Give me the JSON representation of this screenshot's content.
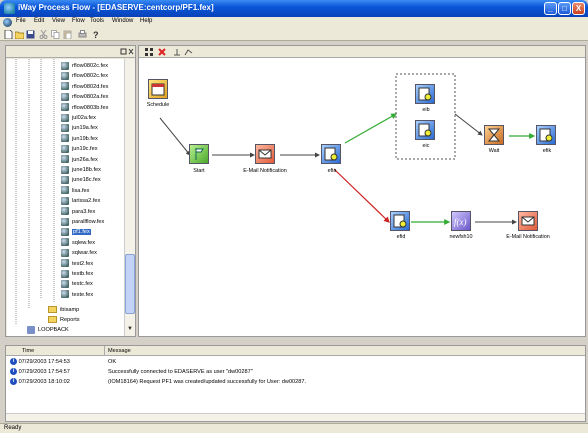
{
  "window": {
    "title": "iWay Process Flow - [EDASERVE:centcorp/PF1.fex]",
    "minimize": "_",
    "maximize": "□",
    "close": "X"
  },
  "menu": [
    "File",
    "Edit",
    "View",
    "Flow",
    "Tools",
    "Window",
    "Help"
  ],
  "toolbar_icons": [
    "new-icon",
    "open-icon",
    "save-icon",
    "cut-icon",
    "copy-icon",
    "paste-icon",
    "print-icon",
    "help-icon"
  ],
  "canvas_toolbar_icons": [
    "grid-icon",
    "delete-icon",
    "align-icon",
    "route-icon"
  ],
  "tree": {
    "items": [
      "rflow0802c.fex",
      "rflow0802c.fex",
      "rflow0802d.fex",
      "rflow0802a.fex",
      "rflow0803b.fex",
      "jul02a.fex",
      "jun19a.fex",
      "jun19b.fex",
      "jun19c.fex",
      "jun26a.fex",
      "june18b.fex",
      "june18c.fex",
      "lisa.fex",
      "larissa2.fex",
      "para3.fex",
      "parallflow.fex",
      "pf1.fex",
      "sqlew.fex",
      "sqlwar.fex",
      "test2.fex",
      "testb.fex",
      "testc.fex",
      "teste.fex"
    ],
    "selected_index": 16,
    "folders": [
      "ibisamp",
      "Reports",
      "LOOPBACK"
    ]
  },
  "flow": {
    "nodes": {
      "schedule": "Schedule",
      "start": "Start",
      "email1": "E-Mail Notification",
      "efia": "efia",
      "eib": "eib",
      "eic": "eic",
      "wait": "Wait",
      "efik": "efik",
      "efid": "efid",
      "newfsh": "newfsh10",
      "email2": "E-Mail Notification"
    },
    "colors": {
      "arrow_green": "#33aa33",
      "arrow_red": "#cc2222",
      "arrow_gray": "#444444"
    }
  },
  "log": {
    "columns": [
      "Time",
      "Message"
    ],
    "rows": [
      {
        "time": "07/29/2003 17:54:53",
        "message": "OK"
      },
      {
        "time": "07/29/2003 17:54:57",
        "message": "Successfully connected to EDASERVE as user \"dw00287\""
      },
      {
        "time": "07/29/2003 18:10:02",
        "message": "(IOM18164) Request PF1 was created/updated successfully for User: dw00287."
      }
    ]
  },
  "status": {
    "text": "Ready"
  }
}
